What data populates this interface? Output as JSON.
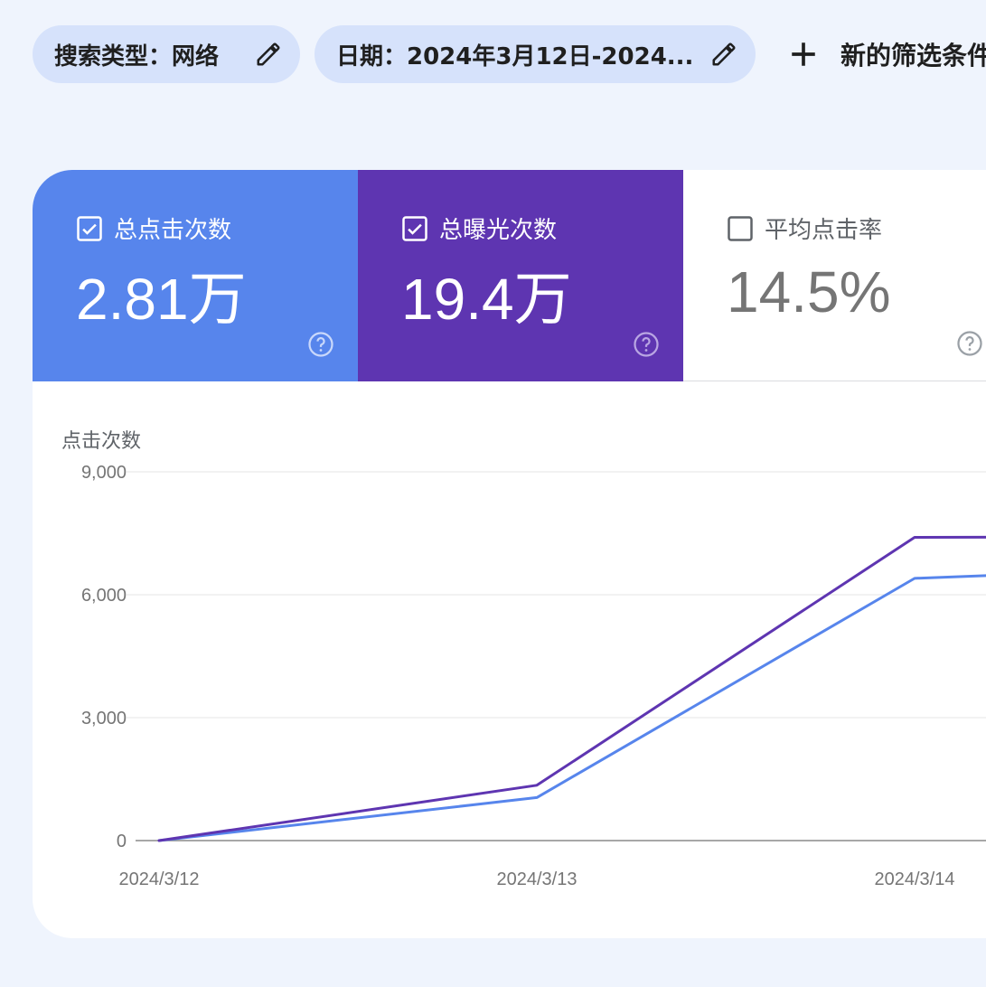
{
  "filters": {
    "search_type": "搜索类型：网络",
    "date": "日期：2024年3月12日-2024...",
    "add_filter": "新的筛选条件"
  },
  "metrics": [
    {
      "label": "总点击次数",
      "value": "2.81万",
      "checked": true,
      "color": "#5785ec"
    },
    {
      "label": "总曝光次数",
      "value": "19.4万",
      "checked": true,
      "color": "#5e35b1"
    },
    {
      "label": "平均点击率",
      "value": "14.5%",
      "checked": false
    }
  ],
  "chart_data": {
    "type": "line",
    "ylabel": "点击次数",
    "categories": [
      "2024/3/12",
      "2024/3/13",
      "2024/3/14"
    ],
    "y_ticks": [
      "9,000",
      "6,000",
      "3,000",
      "0"
    ],
    "ylim": [
      0,
      9000
    ],
    "grid": true,
    "series": [
      {
        "values": [
          0,
          1050,
          6400,
          6750
        ],
        "color": "#5785ec"
      },
      {
        "values": [
          0,
          1350,
          7400,
          7420
        ],
        "color": "#5e35b1"
      }
    ]
  }
}
